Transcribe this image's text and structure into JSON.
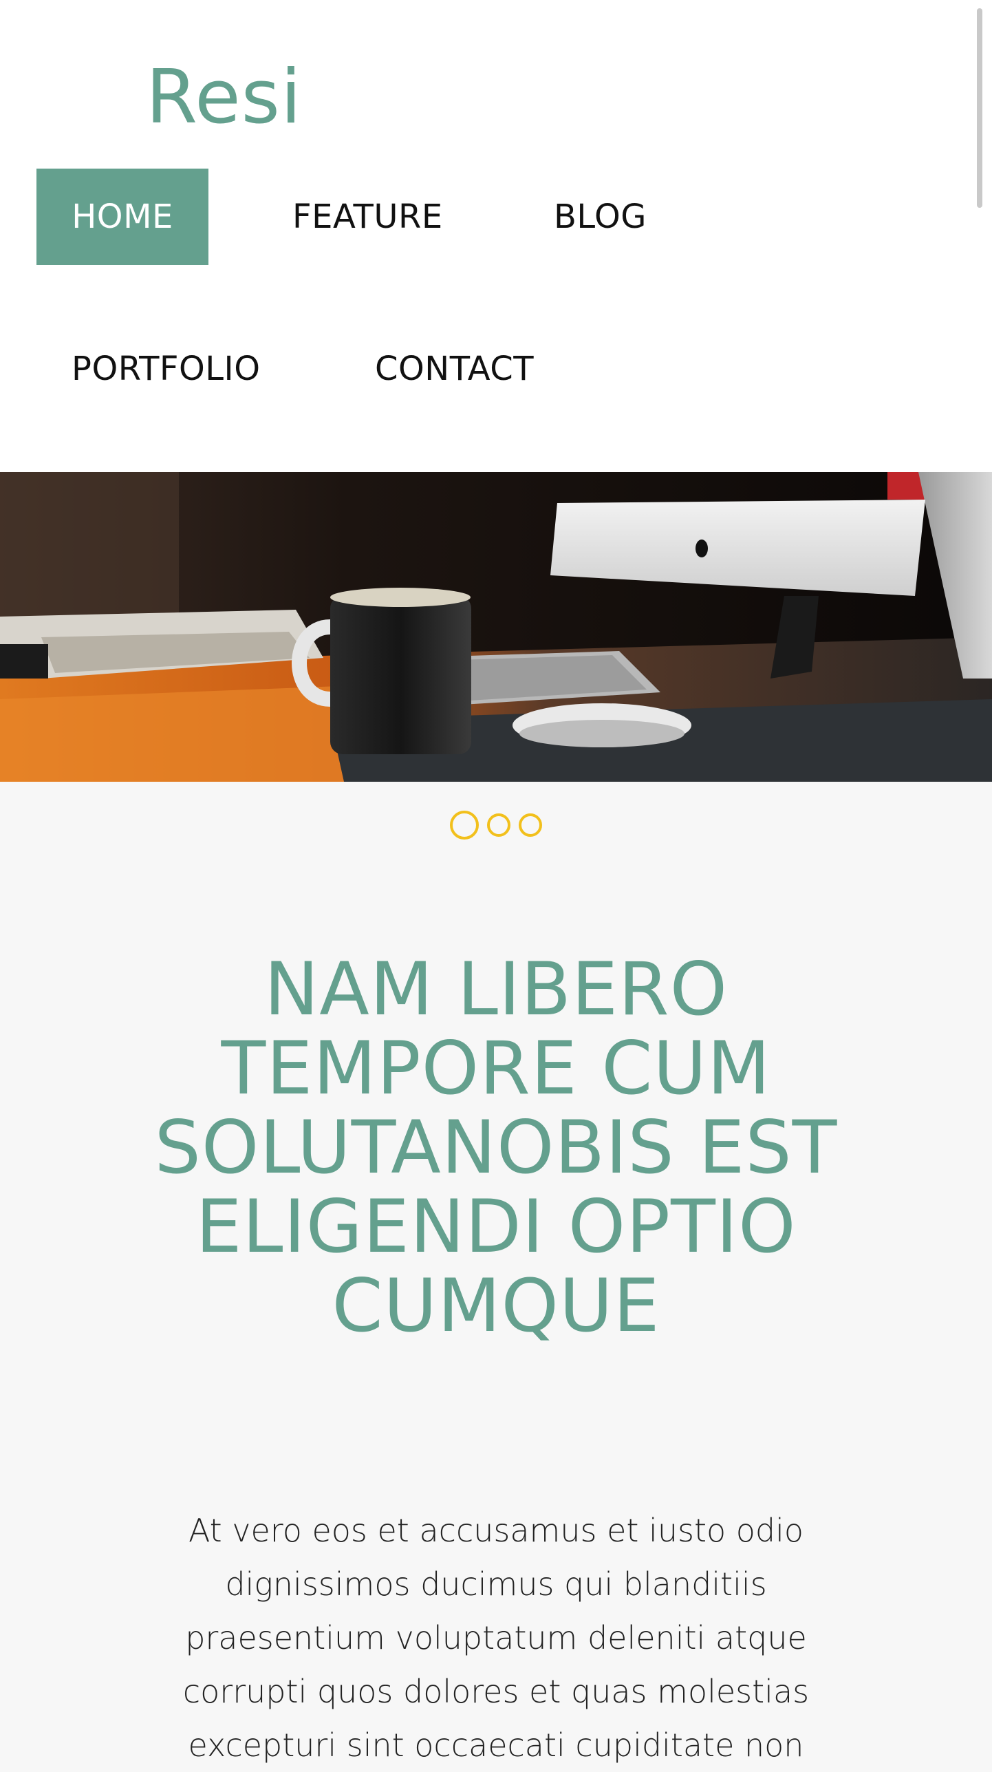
{
  "header": {
    "logo": "Resi",
    "nav": [
      {
        "label": "HOME",
        "active": true
      },
      {
        "label": "FEATURE",
        "active": false
      },
      {
        "label": "BLOG",
        "active": false
      },
      {
        "label": "PORTFOLIO",
        "active": false
      },
      {
        "label": "CONTACT",
        "active": false
      }
    ]
  },
  "hero": {
    "image": "desk-workspace-photo",
    "slider_dots": 3,
    "active_dot": 0
  },
  "main": {
    "headline": "NAM LIBERO TEMPORE CUM SOLUTANOBIS EST ELIGENDI OPTIO CUMQUE",
    "paragraph": "At vero eos et accusamus et iusto odio dignissimos ducimus qui blanditiis praesentium voluptatum deleniti atque corrupti quos dolores et quas molestias excepturi sint occaecati cupiditate non"
  },
  "colors": {
    "accent": "#64a08e",
    "dot": "#f2c01c",
    "header_bg": "#ffffff",
    "page_bg": "#f7f7f7",
    "nav_text": "#111111"
  },
  "icons": {
    "slider_dot": "circle-outline-icon"
  }
}
